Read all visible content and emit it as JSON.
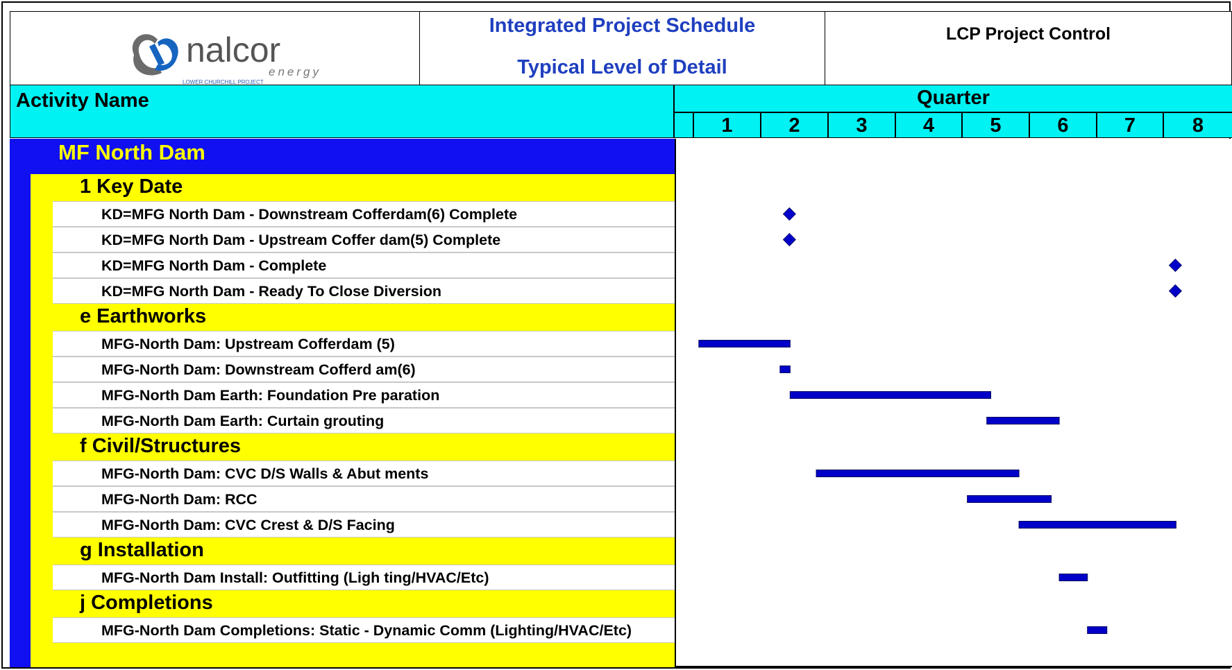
{
  "header": {
    "logo_name": "nalcor",
    "logo_sub": "energy",
    "logo_tagline": "LOWER CHURCHILL PROJECT",
    "title_line1": "Integrated Project Schedule",
    "title_line2": "Typical Level of Detail",
    "control_title": "LCP Project Control"
  },
  "columns": {
    "activity_header": "Activity Name",
    "timeline_header": "Quarter",
    "quarters": [
      "1",
      "2",
      "3",
      "4",
      "5",
      "6",
      "7",
      "8"
    ]
  },
  "colors": {
    "header_cyan": "#00f2f2",
    "project_blue": "#1010f0",
    "group_yellow": "#ffff00",
    "bar_blue": "#0000c8",
    "title_blue": "#1f3fbf",
    "project_text": "#ffff00"
  },
  "project": {
    "label": "MF North Dam"
  },
  "chart_data": {
    "type": "gantt",
    "x_axis": {
      "label": "Quarter",
      "ticks": [
        "1",
        "2",
        "3",
        "4",
        "5",
        "6",
        "7",
        "8"
      ],
      "range": [
        0,
        8
      ]
    },
    "groups": [
      {
        "label": "1 Key Date",
        "activities": [
          {
            "label": "KD=MFG  North Dam - Downstream Cofferdam(6) Complete",
            "type": "milestone",
            "at": 1.4
          },
          {
            "label": "KD=MFG  North Dam - Upstream Coffer dam(5) Complete",
            "type": "milestone",
            "at": 1.4
          },
          {
            "label": "KD=MFG  North Dam - Complete",
            "type": "milestone",
            "at": 7.15
          },
          {
            "label": "KD=MFG  North Dam - Ready To Close Diversion",
            "type": "milestone",
            "at": 7.15
          }
        ]
      },
      {
        "label": "e Earthworks",
        "activities": [
          {
            "label": "MFG-North Dam: Upstream Cofferdam (5)",
            "type": "bar",
            "start": 0.05,
            "end": 1.41
          },
          {
            "label": "MFG-North Dam: Downstream Cofferd am(6)",
            "type": "bar",
            "start": 1.26,
            "end": 1.41
          },
          {
            "label": "MFG-North Dam Earth:  Foundation Pre paration",
            "type": "bar",
            "start": 1.41,
            "end": 4.4
          },
          {
            "label": "MFG-North Dam Earth:  Curtain grouting",
            "type": "bar",
            "start": 4.34,
            "end": 5.42
          }
        ]
      },
      {
        "label": "f Civil/Structures",
        "activities": [
          {
            "label": "MFG-North Dam: CVC D/S Walls & Abut ments",
            "type": "bar",
            "start": 1.8,
            "end": 4.82
          },
          {
            "label": "MFG-North Dam: RCC",
            "type": "bar",
            "start": 4.05,
            "end": 5.3
          },
          {
            "label": "MFG-North Dam: CVC Crest & D/S Facing",
            "type": "bar",
            "start": 4.82,
            "end": 7.16
          }
        ]
      },
      {
        "label": "g Installation",
        "activities": [
          {
            "label": "MFG-North Dam Install: Outfitting (Ligh ting/HVAC/Etc)",
            "type": "bar",
            "start": 5.42,
            "end": 5.84
          }
        ]
      },
      {
        "label": "j Completions",
        "activities": [
          {
            "label": "MFG-North Dam Completions: Static - Dynamic Comm (Lighting/HVAC/Etc)",
            "type": "bar",
            "start": 5.84,
            "end": 6.13
          }
        ]
      }
    ]
  }
}
